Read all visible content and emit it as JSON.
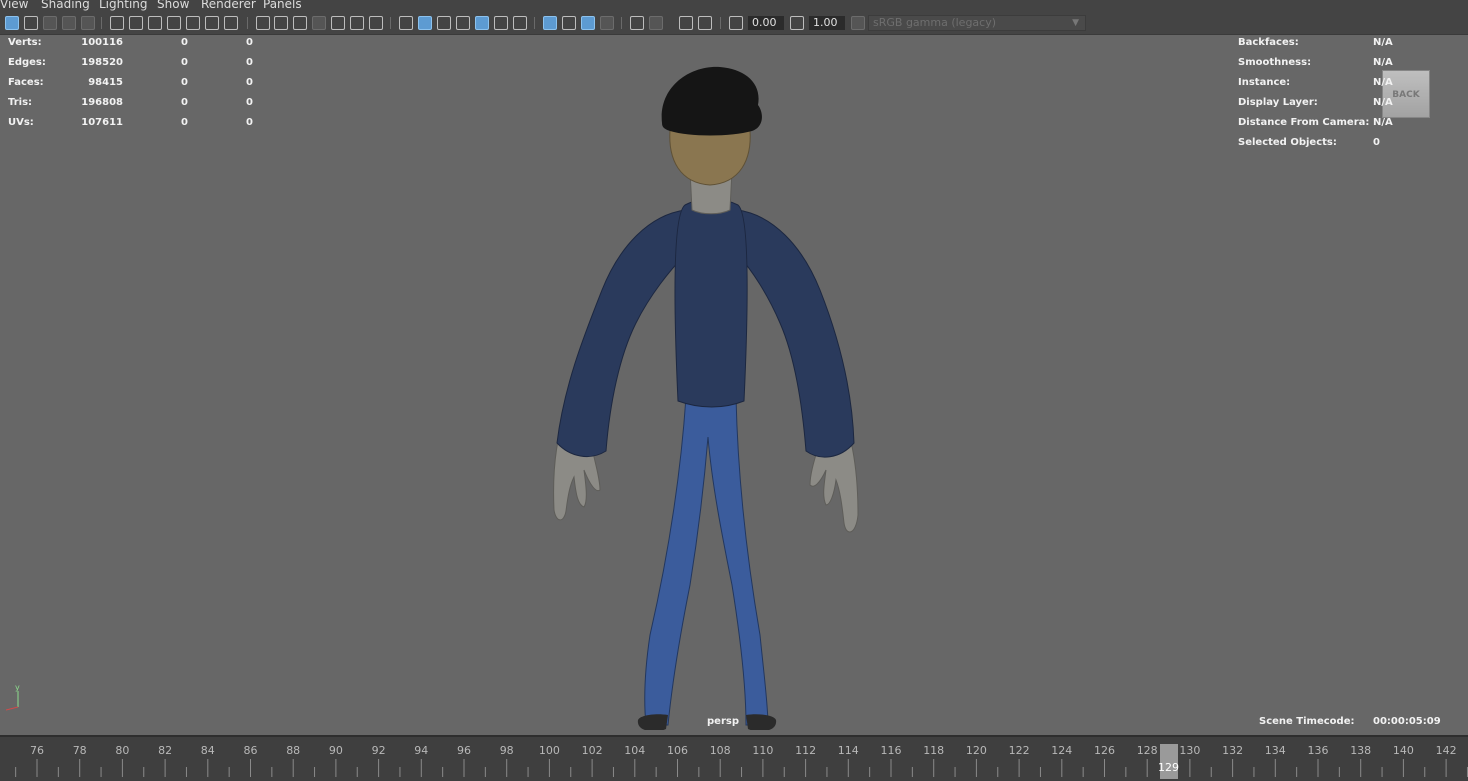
{
  "menu": [
    "View",
    "Shading",
    "Lighting",
    "Show",
    "Renderer",
    "Panels"
  ],
  "toolbar": {
    "exposure_value": "0.00",
    "gamma_value": "1.00",
    "color_space": "sRGB gamma (legacy)"
  },
  "hud_left": {
    "rows": [
      {
        "label": "Verts:",
        "total": "100116",
        "selected": "0",
        "components": "0"
      },
      {
        "label": "Edges:",
        "total": "198520",
        "selected": "0",
        "components": "0"
      },
      {
        "label": "Faces:",
        "total": "98415",
        "selected": "0",
        "components": "0"
      },
      {
        "label": "Tris:",
        "total": "196808",
        "selected": "0",
        "components": "0"
      },
      {
        "label": "UVs:",
        "total": "107611",
        "selected": "0",
        "components": "0"
      }
    ]
  },
  "hud_right": {
    "rows": [
      {
        "label": "Backfaces:",
        "value": "N/A"
      },
      {
        "label": "Smoothness:",
        "value": "N/A"
      },
      {
        "label": "Instance:",
        "value": "N/A"
      },
      {
        "label": "Display Layer:",
        "value": "N/A"
      },
      {
        "label": "Distance From Camera:",
        "value": "N/A"
      },
      {
        "label": "Selected Objects:",
        "value": "0"
      }
    ]
  },
  "view_cube_label": "BACK",
  "camera_name": "persp",
  "axis_label": "y",
  "timecode": {
    "label": "Scene Timecode:",
    "value": "00:00:05:09"
  },
  "timeline": {
    "labels": [
      "76",
      "78",
      "80",
      "82",
      "84",
      "86",
      "88",
      "90",
      "92",
      "94",
      "96",
      "98",
      "100",
      "102",
      "104",
      "106",
      "108",
      "110",
      "112",
      "114",
      "116",
      "118",
      "120",
      "122",
      "124",
      "126",
      "128",
      "130",
      "132",
      "134",
      "136",
      "138",
      "140",
      "142"
    ],
    "current_frame": "129"
  },
  "colors": {
    "viewport_bg": "#676767",
    "ui_bg": "#444444",
    "active_icon": "#5d9bd2",
    "shirt": "#2a3a5c",
    "pants": "#3b5c9c",
    "skin": "#8c8b86",
    "hat": "#151515",
    "hair": "#8a7650"
  }
}
